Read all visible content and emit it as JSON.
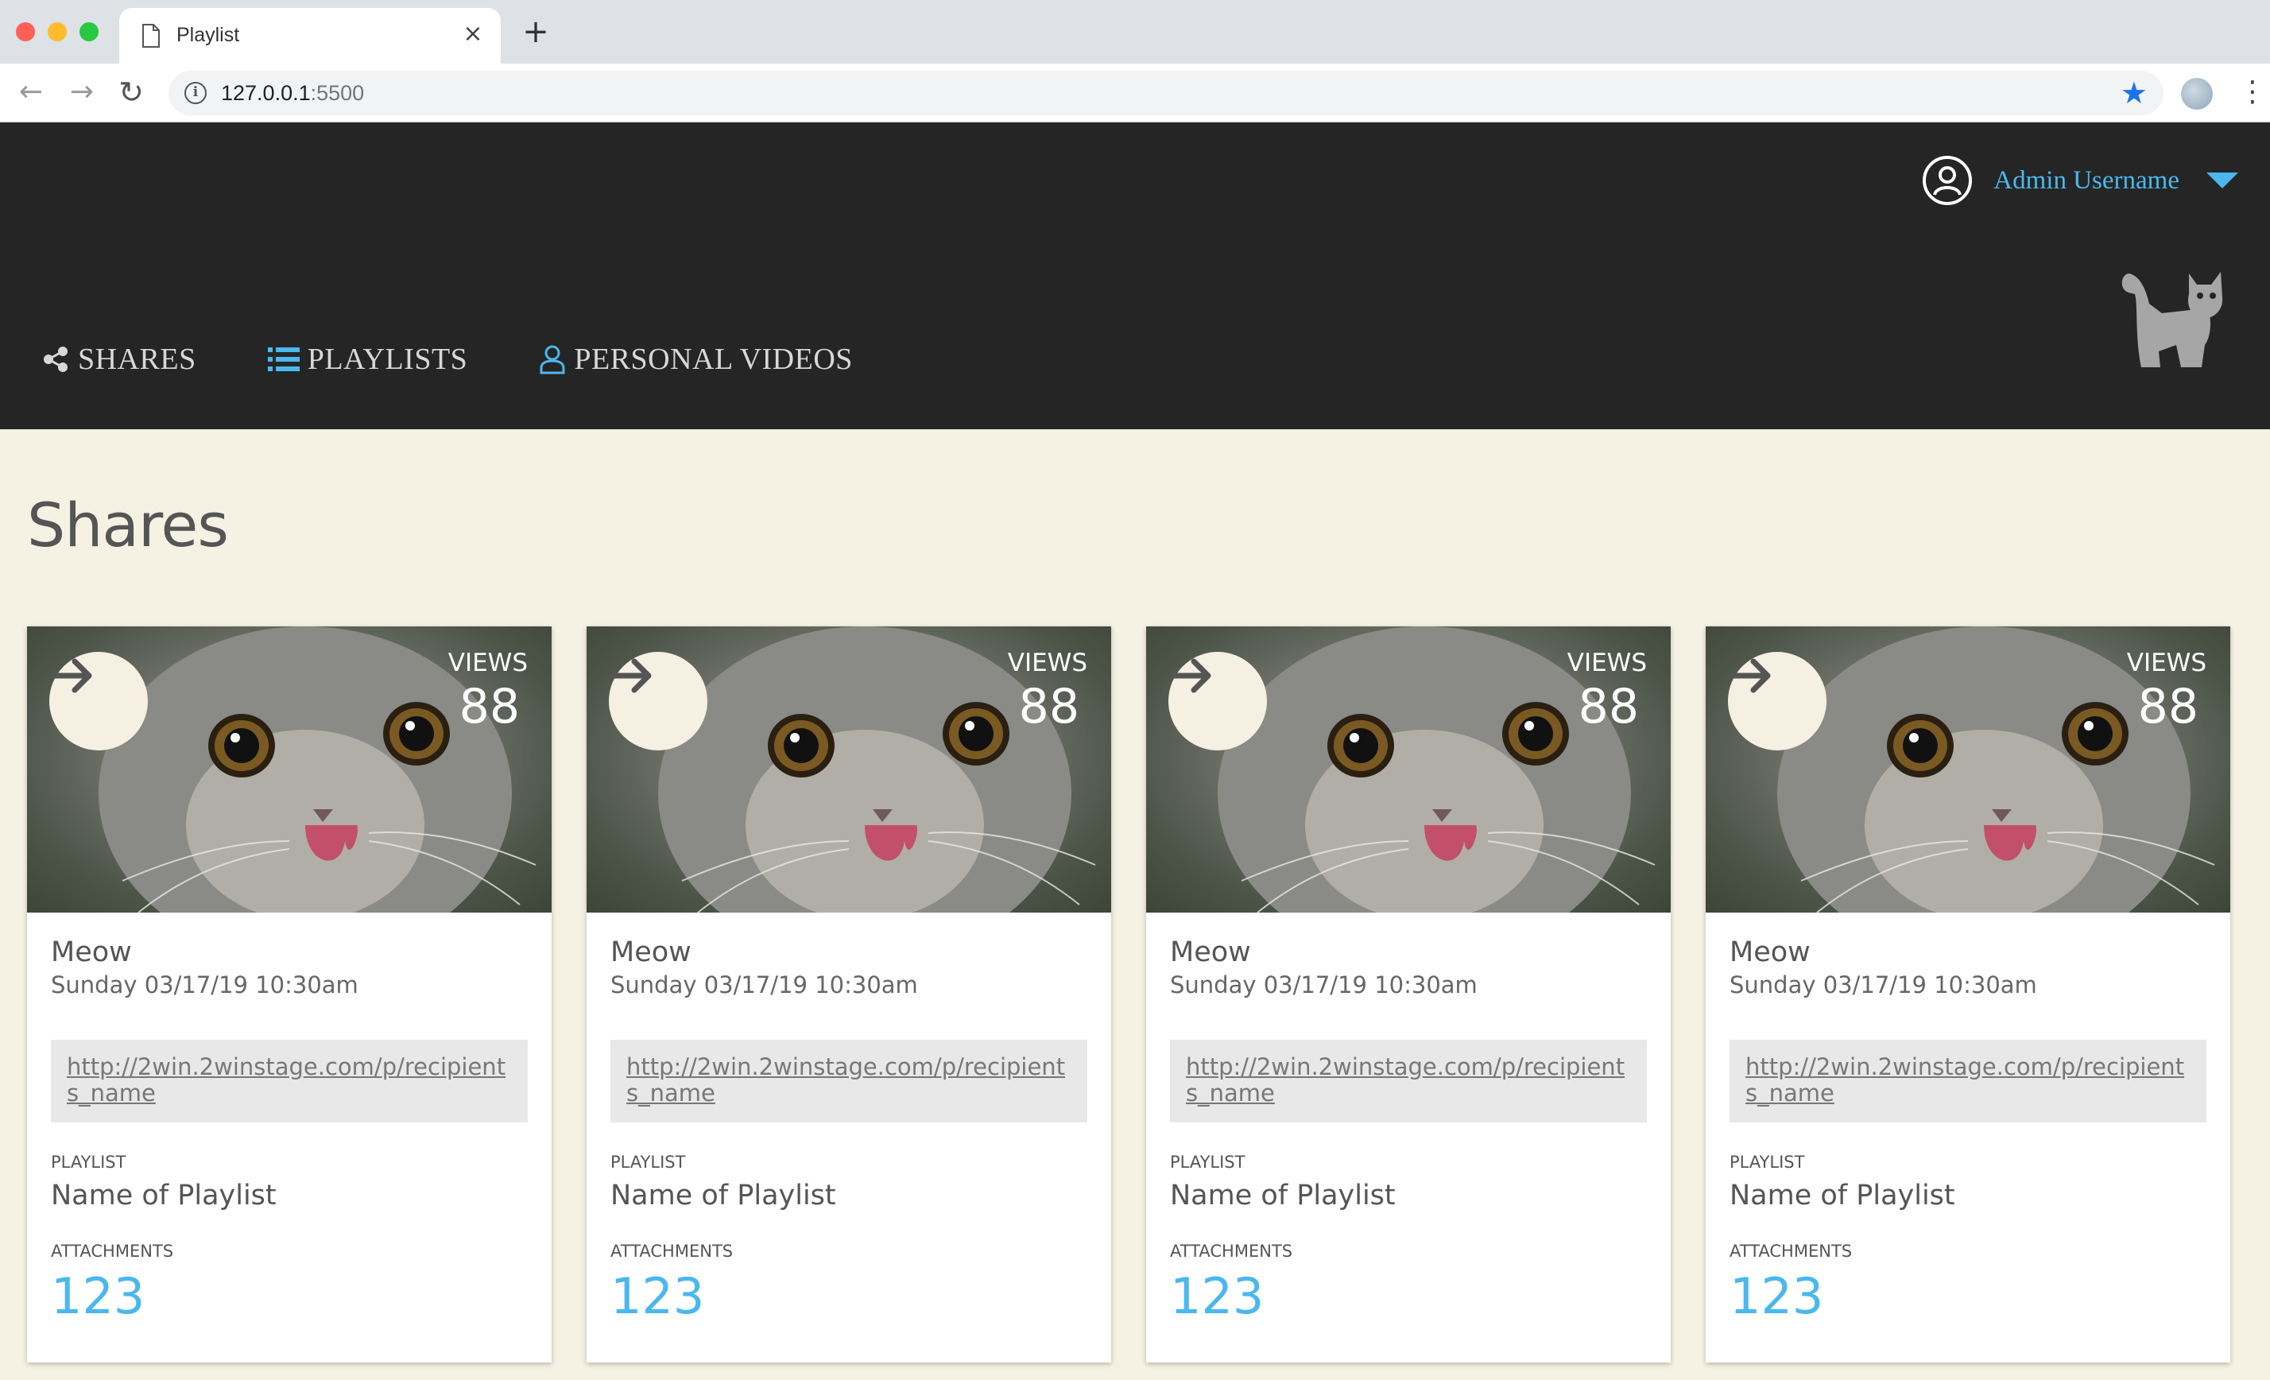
{
  "browser": {
    "tab_title": "Playlist",
    "url_host": "127.0.0.1",
    "url_port": ":5500"
  },
  "header": {
    "username": "Admin Username",
    "accent_color": "#4ab8ee",
    "nav": [
      {
        "label": "SHARES",
        "icon": "share-icon"
      },
      {
        "label": "PLAYLISTS",
        "icon": "list-icon"
      },
      {
        "label": "PERSONAL VIDEOS",
        "icon": "user-icon"
      }
    ]
  },
  "page": {
    "title": "Shares"
  },
  "cards": [
    {
      "views_label": "VIEWS",
      "views": "88",
      "title": "Meow",
      "date": "Sunday 03/17/19 10:30am",
      "link": "http://2win.2winstage.com/p/recipients_name",
      "playlist_label": "PLAYLIST",
      "playlist_name": "Name of Playlist",
      "attachments_label": "ATTACHMENTS",
      "attachments": "123"
    },
    {
      "views_label": "VIEWS",
      "views": "88",
      "title": "Meow",
      "date": "Sunday 03/17/19 10:30am",
      "link": "http://2win.2winstage.com/p/recipients_name",
      "playlist_label": "PLAYLIST",
      "playlist_name": "Name of Playlist",
      "attachments_label": "ATTACHMENTS",
      "attachments": "123"
    },
    {
      "views_label": "VIEWS",
      "views": "88",
      "title": "Meow",
      "date": "Sunday 03/17/19 10:30am",
      "link": "http://2win.2winstage.com/p/recipients_name",
      "playlist_label": "PLAYLIST",
      "playlist_name": "Name of Playlist",
      "attachments_label": "ATTACHMENTS",
      "attachments": "123"
    },
    {
      "views_label": "VIEWS",
      "views": "88",
      "title": "Meow",
      "date": "Sunday 03/17/19 10:30am",
      "link": "http://2win.2winstage.com/p/recipients_name",
      "playlist_label": "PLAYLIST",
      "playlist_name": "Name of Playlist",
      "attachments_label": "ATTACHMENTS",
      "attachments": "123"
    }
  ]
}
